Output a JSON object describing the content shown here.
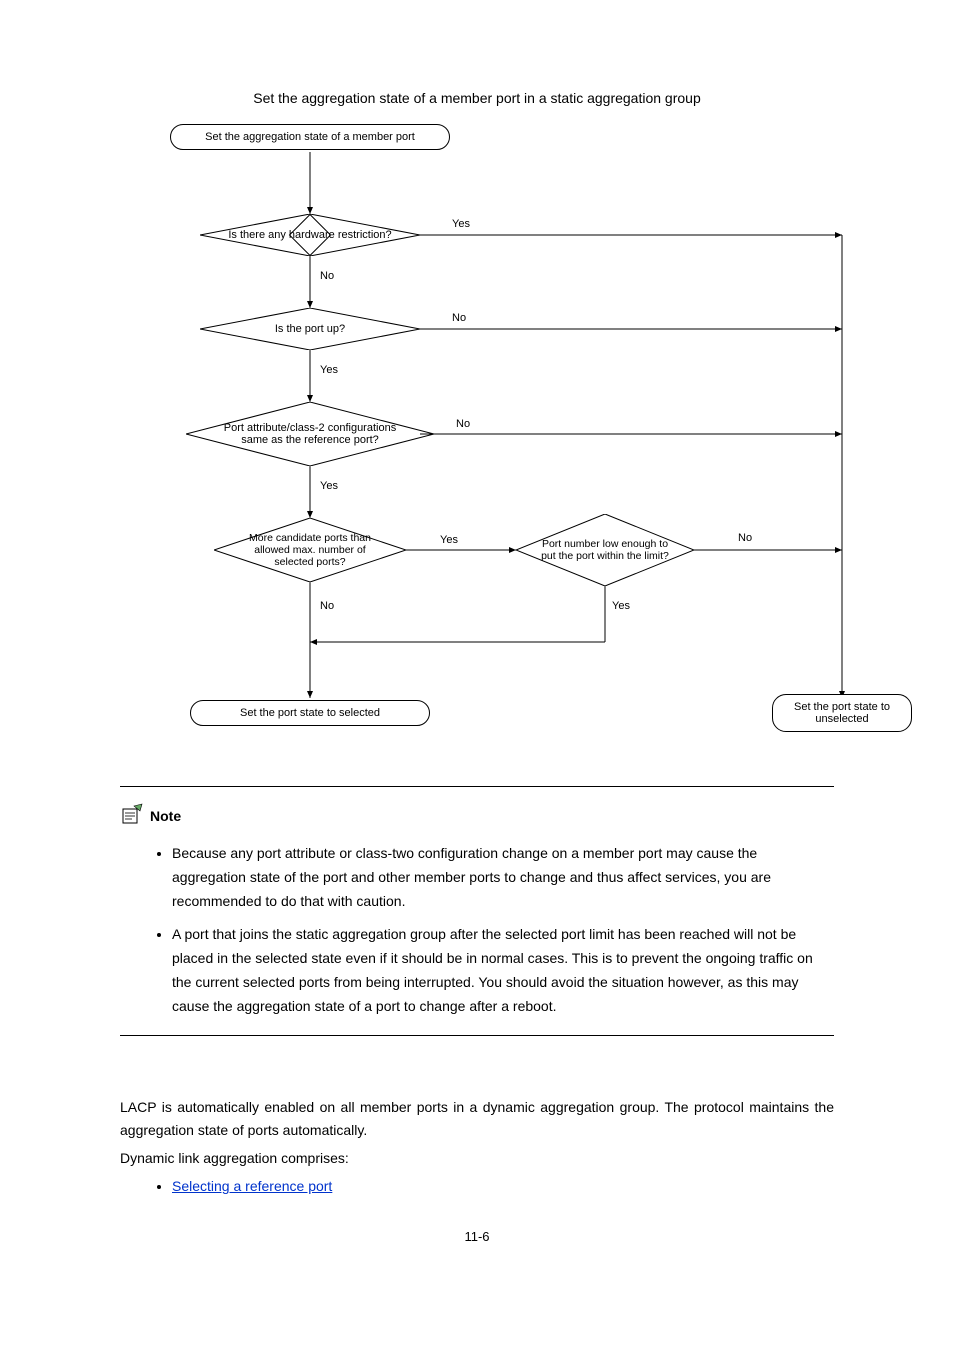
{
  "figure_title": "Set the aggregation state of a member port in a static aggregation group",
  "flow": {
    "start": "Set the aggregation state of a member port",
    "d1": "Is there any hardware restriction?",
    "d2": "Is the port up?",
    "d3": "Port attribute/class-2 configurations same as the reference port?",
    "d4": "More candidate ports than allowed max. number of selected ports?",
    "d5": "Port number low enough to put the port within the limit?",
    "end_selected": "Set the port state to selected",
    "end_unselected": "Set the port state to unselected"
  },
  "labels": {
    "yes": "Yes",
    "no": "No"
  },
  "note": {
    "heading": "Note",
    "items": [
      "Because any port attribute or class-two configuration change on a member port may cause the aggregation state of the port and other member ports to change and thus affect services, you are recommended to do that with caution.",
      "A port that joins the static aggregation group after the selected port limit has been reached will not be placed in the selected state even if it should be in normal cases. This is to prevent the ongoing traffic on the current selected ports from being interrupted. You should avoid the situation however, as this may cause the aggregation state of a port to change after a reboot."
    ]
  },
  "body": {
    "p1": "LACP is automatically enabled on all member ports in a dynamic aggregation group. The protocol maintains the aggregation state of ports automatically.",
    "p2": "Dynamic link aggregation comprises:",
    "link1": "Selecting a reference port"
  },
  "page_number": "11-6",
  "chart_data": {
    "type": "flowchart",
    "nodes": [
      {
        "id": "start",
        "kind": "terminal",
        "text": "Set the aggregation state of a member port"
      },
      {
        "id": "d1",
        "kind": "decision",
        "text": "Is there any hardware restriction?"
      },
      {
        "id": "d2",
        "kind": "decision",
        "text": "Is the port up?"
      },
      {
        "id": "d3",
        "kind": "decision",
        "text": "Port attribute/class-2 configurations same as the reference port?"
      },
      {
        "id": "d4",
        "kind": "decision",
        "text": "More candidate ports than allowed max. number of selected ports?"
      },
      {
        "id": "d5",
        "kind": "decision",
        "text": "Port number low enough to put the port within the limit?"
      },
      {
        "id": "end_selected",
        "kind": "terminal",
        "text": "Set the port state to selected"
      },
      {
        "id": "end_unselected",
        "kind": "terminal",
        "text": "Set the port state to unselected"
      }
    ],
    "edges": [
      {
        "from": "start",
        "to": "d1",
        "label": ""
      },
      {
        "from": "d1",
        "to": "end_unselected",
        "label": "Yes"
      },
      {
        "from": "d1",
        "to": "d2",
        "label": "No"
      },
      {
        "from": "d2",
        "to": "end_unselected",
        "label": "No"
      },
      {
        "from": "d2",
        "to": "d3",
        "label": "Yes"
      },
      {
        "from": "d3",
        "to": "end_unselected",
        "label": "No"
      },
      {
        "from": "d3",
        "to": "d4",
        "label": "Yes"
      },
      {
        "from": "d4",
        "to": "end_selected",
        "label": "No"
      },
      {
        "from": "d4",
        "to": "d5",
        "label": "Yes"
      },
      {
        "from": "d5",
        "to": "end_unselected",
        "label": "No"
      },
      {
        "from": "d5",
        "to": "end_selected",
        "label": "Yes"
      }
    ]
  }
}
